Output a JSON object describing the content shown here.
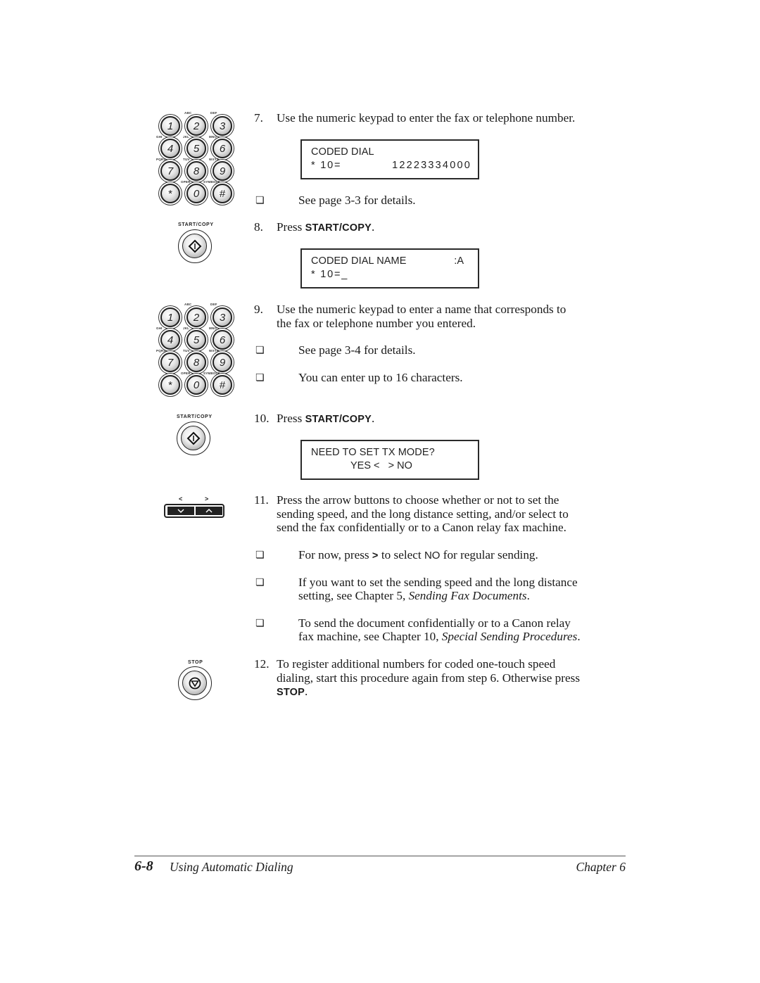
{
  "steps": {
    "s7": {
      "number": "7.",
      "text": "Use the numeric keypad to enter the fax or telephone number.",
      "display": {
        "line1": "CODED DIAL",
        "line2_left": "* 10=",
        "line2_right": "12223334000"
      },
      "bullets": [
        "See page 3-3 for details."
      ]
    },
    "s8": {
      "number": "8.",
      "text_prefix": "Press ",
      "key": "START/COPY",
      "text_suffix": ".",
      "display": {
        "line1": "CODED DIAL NAME",
        "line1_right": ":A",
        "line2_left": "* 10=_"
      }
    },
    "s9": {
      "number": "9.",
      "lines": [
        "Use the numeric keypad to enter a name that corresponds to",
        "the fax or telephone number you entered."
      ],
      "bullets": [
        "See page 3-4 for details.",
        "You can enter up to 16 characters."
      ]
    },
    "s10": {
      "number": "10.",
      "text_prefix": "Press ",
      "key": "START/COPY",
      "text_suffix": ".",
      "display": {
        "line1": "NEED TO SET TX MODE?",
        "line2": "YES <   > NO"
      }
    },
    "s11": {
      "number": "11.",
      "lines": [
        "Press the arrow buttons to choose whether or not to set the",
        "sending speed, and the long distance setting, and/or select to",
        "send the fax confidentially or to a Canon relay fax machine."
      ],
      "bullet1": {
        "a": "For now, press ",
        "key": ">",
        "b": " to select ",
        "val": "NO",
        "c": " for regular sending."
      },
      "bullet2": {
        "line1": "If you want to set the sending speed and the long distance",
        "line2_a": "setting, see Chapter 5, ",
        "line2_em": "Sending Fax Documents",
        "line2_b": "."
      },
      "bullet3": {
        "line1": "To send the document confidentially or to a Canon relay",
        "line2_a": "fax machine, see Chapter 10, ",
        "line2_em": "Special Sending Procedures",
        "line2_b": "."
      }
    },
    "s12": {
      "number": "12.",
      "lines": [
        "To register additional numbers for coded one-touch speed",
        "dialing, start this procedure again from step 6. Otherwise press"
      ],
      "key": "STOP",
      "suffix": "."
    }
  },
  "illustrations": {
    "keypad_keys": [
      "1",
      "2",
      "3",
      "4",
      "5",
      "6",
      "7",
      "8",
      "9",
      "*",
      "0",
      "#"
    ],
    "keypad_labels": [
      "ABC",
      "DEF",
      "GHI",
      "JKL",
      "MNO",
      "PQRS",
      "TUV",
      "WXYZ",
      "OPER",
      "SYMBOLS"
    ],
    "start_copy_caption": "START/COPY",
    "stop_caption": "STOP",
    "arrow_left": "<",
    "arrow_right": ">"
  },
  "footer": {
    "page_number": "6-8",
    "title": "Using Automatic Dialing",
    "chapter": "Chapter 6"
  }
}
